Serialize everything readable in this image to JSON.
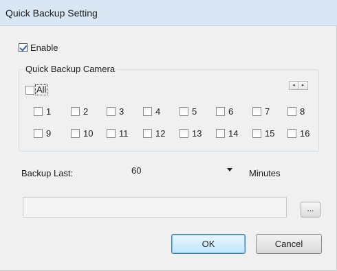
{
  "window": {
    "title": "Quick Backup Setting"
  },
  "enable": {
    "label": "Enable",
    "checked": true
  },
  "camera_group": {
    "title": "Quick Backup Camera",
    "all_label": "All",
    "all_checked": false,
    "spin_left": "◂",
    "spin_right": "▸",
    "cameras": [
      "1",
      "2",
      "3",
      "4",
      "5",
      "6",
      "7",
      "8",
      "9",
      "10",
      "11",
      "12",
      "13",
      "14",
      "15",
      "16"
    ]
  },
  "backup_last": {
    "label": "Backup Last:",
    "value": "60",
    "unit": "Minutes"
  },
  "path": {
    "value": ""
  },
  "browse_label": "...",
  "buttons": {
    "ok": "OK",
    "cancel": "Cancel"
  }
}
